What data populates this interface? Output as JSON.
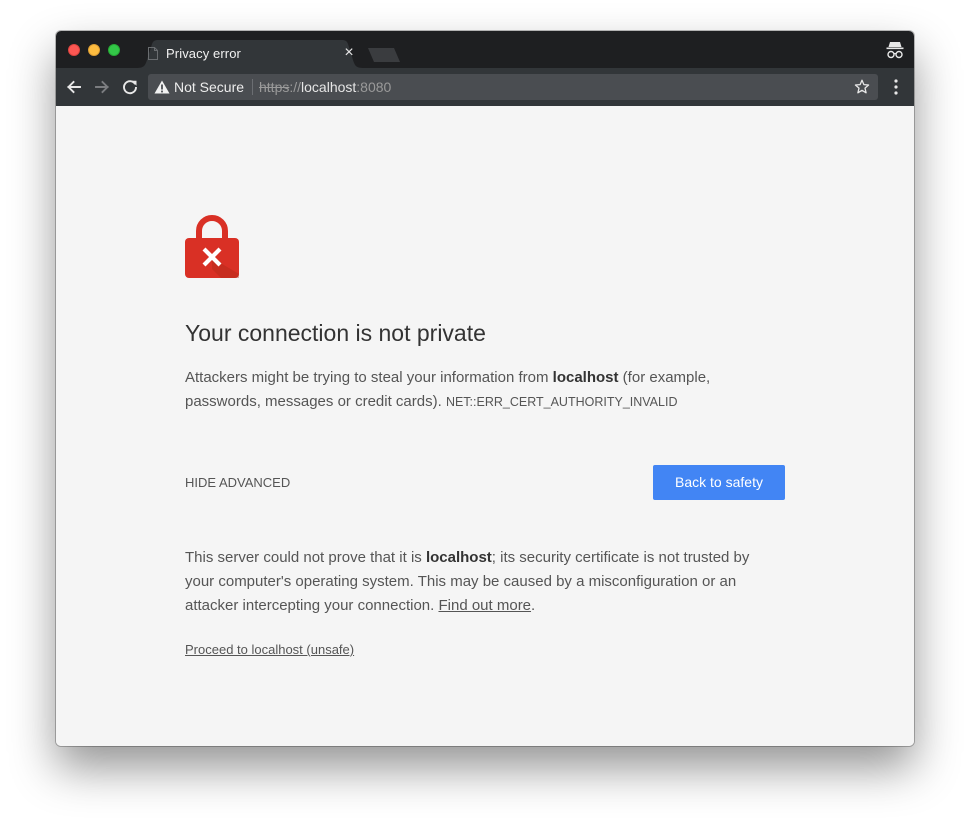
{
  "tab": {
    "title": "Privacy error",
    "close_glyph": "×"
  },
  "toolbar": {
    "security_label": "Not Secure",
    "url_scheme": "https",
    "url_separator": "://",
    "url_host": "localhost",
    "url_port": ":8080"
  },
  "page": {
    "headline": "Your connection is not private",
    "main_msg_prefix": "Attackers might be trying to steal your information from ",
    "main_msg_host": "localhost",
    "main_msg_suffix": " (for example, passwords, messages or credit cards). ",
    "error_code": "NET::ERR_CERT_AUTHORITY_INVALID",
    "hide_advanced": "HIDE ADVANCED",
    "back_button": "Back to safety",
    "details_prefix": "This server could not prove that it is ",
    "details_host": "localhost",
    "details_suffix": "; its security certificate is not trusted by your computer's operating system. This may be caused by a misconfiguration or an attacker intercepting your connection. ",
    "learn_more": "Find out more",
    "details_end": ".",
    "proceed_link": "Proceed to localhost (unsafe)"
  },
  "colors": {
    "accent": "#4285f4",
    "lock_red": "#d93025",
    "page_bg": "#f5f5f5",
    "toolbar_bg": "#323639",
    "tabstrip_bg": "#1e1f21"
  },
  "icons": {
    "tab_favicon": "page-icon",
    "new_tab": "new-tab-icon",
    "incognito": "incognito-icon",
    "back": "arrow-left-icon",
    "forward": "arrow-right-icon",
    "reload": "reload-icon",
    "security": "warning-icon",
    "bookmark": "star-icon",
    "menu": "kebab-menu-icon",
    "page_hero": "lock-error-icon"
  }
}
